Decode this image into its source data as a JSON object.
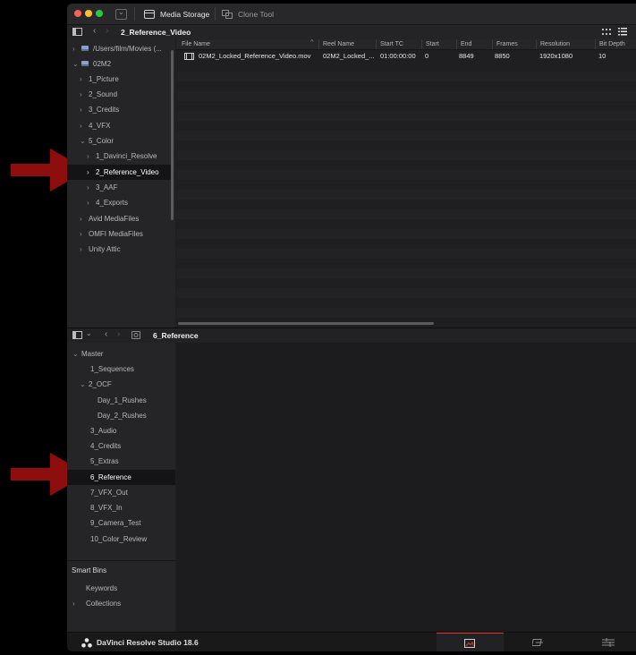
{
  "colors": {
    "arrow": "#8e0e0e",
    "traffic_close": "#ff5f57",
    "traffic_min": "#febc2e",
    "traffic_max": "#28c840",
    "page_active": "#d93a2b"
  },
  "toolbar": {
    "media_storage_label": "Media Storage",
    "clone_tool_label": "Clone Tool"
  },
  "storage_browser": {
    "title": "2_Reference_Video",
    "tree": [
      {
        "label": "/Users/film/Movies (...",
        "icon": "drive-icon"
      },
      {
        "label": "02M2",
        "icon": "drive-icon"
      },
      {
        "label": "1_Picture"
      },
      {
        "label": "2_Sound"
      },
      {
        "label": "3_Credits"
      },
      {
        "label": "4_VFX"
      },
      {
        "label": "5_Color"
      },
      {
        "label": "1_Davinci_Resolve"
      },
      {
        "label": "2_Reference_Video"
      },
      {
        "label": "3_AAF"
      },
      {
        "label": "4_Exports"
      },
      {
        "label": "Avid MediaFiles"
      },
      {
        "label": "OMFI MediaFiles"
      },
      {
        "label": "Unity Attic"
      }
    ]
  },
  "file_list": {
    "columns": [
      "File Name",
      "Reel Name",
      "Start TC",
      "Start",
      "End",
      "Frames",
      "Resolution",
      "Bit Depth"
    ],
    "rows": [
      {
        "file_name": "02M2_Locked_Reference_Video.mov",
        "reel_name": "02M2_Locked_...",
        "start_tc": "01:00:00:00",
        "start": "0",
        "end": "8849",
        "frames": "8850",
        "resolution": "1920x1080",
        "bit_depth": "10"
      }
    ]
  },
  "media_pool": {
    "title": "6_Reference",
    "bins": [
      {
        "label": "Master"
      },
      {
        "label": "1_Sequences"
      },
      {
        "label": "2_OCF"
      },
      {
        "label": "Day_1_Rushes"
      },
      {
        "label": "Day_2_Rushes"
      },
      {
        "label": "3_Audio"
      },
      {
        "label": "4_Credits"
      },
      {
        "label": "5_Extras"
      },
      {
        "label": "6_Reference"
      },
      {
        "label": "7_VFX_Out"
      },
      {
        "label": "8_VFX_In"
      },
      {
        "label": "9_Camera_Test"
      },
      {
        "label": "10_Color_Review"
      }
    ],
    "smart_bins": {
      "title": "Smart Bins",
      "items": [
        "Keywords",
        "Collections"
      ]
    }
  },
  "footer": {
    "app_name": "DaVinci Resolve Studio 18.6",
    "pages": [
      "media-page-icon",
      "cut-page-icon",
      "edit-page-icon"
    ]
  }
}
